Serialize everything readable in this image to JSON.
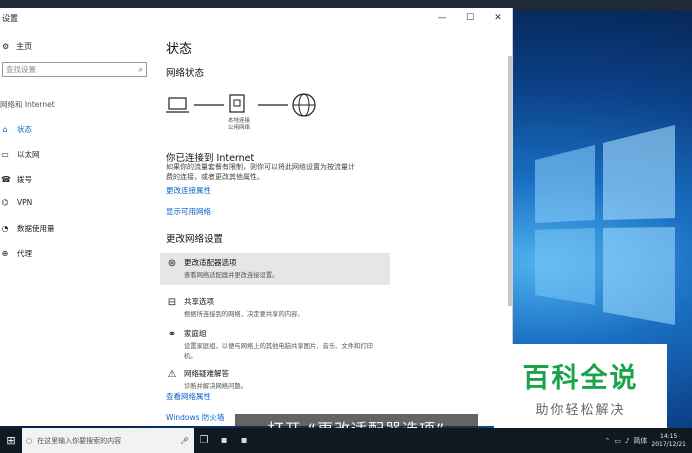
{
  "window": {
    "title": "设置",
    "controls": {
      "minimize": "—",
      "maximize": "☐",
      "close": "✕"
    }
  },
  "sidebar": {
    "home": "主页",
    "search_placeholder": "查找设置",
    "section": "网络和 Internet",
    "items": [
      {
        "label": "状态",
        "icon": "home-globe-icon",
        "active": true
      },
      {
        "label": "以太网",
        "icon": "ethernet-icon"
      },
      {
        "label": "拨号",
        "icon": "dialup-icon"
      },
      {
        "label": "VPN",
        "icon": "vpn-icon"
      },
      {
        "label": "数据使用量",
        "icon": "data-usage-icon"
      },
      {
        "label": "代理",
        "icon": "proxy-globe-icon"
      }
    ]
  },
  "main": {
    "title": "状态",
    "network_status": "网络状态",
    "diagram_label_line1": "本地连接",
    "diagram_label_line2": "公用网络",
    "connected_heading": "你已连接到 Internet",
    "connected_desc_line1": "如果你的流量套餐有限制，则你可以将此网络设置为按流量计",
    "connected_desc_line2": "费的连接，或者更改其他属性。",
    "link_change_props": "更改连接属性",
    "link_show_networks": "显示可用网络",
    "change_settings_heading": "更改网络设置",
    "options": [
      {
        "title": "更改适配器选项",
        "desc": "查看网络适配器并更改连接设置。",
        "icon": "adapter-icon"
      },
      {
        "title": "共享选项",
        "desc": "根据所连接到的网络，决定要共享的内容。",
        "icon": "sharing-icon"
      },
      {
        "title": "家庭组",
        "desc": "设置家庭组，以便与网络上的其他电脑共享图片、音乐、文件和打印",
        "desc2": "机。",
        "icon": "homegroup-icon"
      },
      {
        "title": "网络疑难解答",
        "desc": "诊断并解决网络问题。",
        "icon": "warning-icon"
      }
    ],
    "link_view_props": "查看网络属性",
    "link_firewall": "Windows 防火墙"
  },
  "subtitle": "打开 “更改适配器选项”",
  "watermark": {
    "title": "百科全说",
    "subtitle": "助你轻松解决"
  },
  "taskbar": {
    "search_placeholder": "在这里输入你要搜索的内容",
    "lang": "简体",
    "time": "14:15",
    "date": "2017/12/21"
  },
  "colors": {
    "accent": "#0a63c8",
    "watermark_green": "#1aa34a"
  }
}
